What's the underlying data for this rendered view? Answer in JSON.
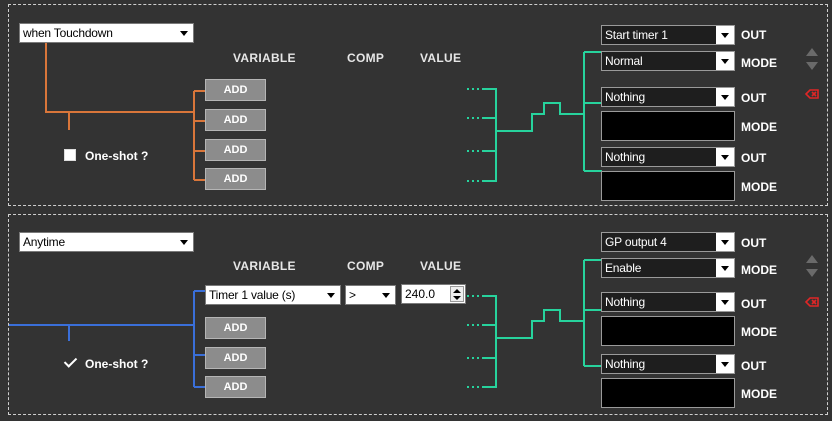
{
  "colors": {
    "orange": "#d9763a",
    "blue": "#3a6fd9",
    "green": "#27d39d",
    "delete": "#e02626"
  },
  "headers": {
    "variable": "VARIABLE",
    "comp": "COMP",
    "value": "VALUE"
  },
  "labels": {
    "out": "OUT",
    "mode": "MODE"
  },
  "rules": [
    {
      "trigger": "when Touchdown",
      "one_shot_label": "One-shot ?",
      "one_shot_checked": false,
      "conditions": [
        {
          "type": "button",
          "label": "ADD"
        },
        {
          "type": "button",
          "label": "ADD"
        },
        {
          "type": "button",
          "label": "ADD"
        },
        {
          "type": "button",
          "label": "ADD"
        }
      ],
      "outputs": [
        {
          "out": "Start timer 1",
          "mode": "Normal"
        },
        {
          "out": "Nothing",
          "mode": ""
        },
        {
          "out": "Nothing",
          "mode": ""
        }
      ]
    },
    {
      "trigger": "Anytime",
      "one_shot_label": "One-shot ?",
      "one_shot_checked": true,
      "conditions": [
        {
          "type": "filled",
          "variable": "Timer 1 value (s)",
          "comp": ">",
          "value": "240.0"
        },
        {
          "type": "button",
          "label": "ADD"
        },
        {
          "type": "button",
          "label": "ADD"
        },
        {
          "type": "button",
          "label": "ADD"
        }
      ],
      "outputs": [
        {
          "out": "GP output 4",
          "mode": "Enable"
        },
        {
          "out": "Nothing",
          "mode": ""
        },
        {
          "out": "Nothing",
          "mode": ""
        }
      ]
    }
  ]
}
